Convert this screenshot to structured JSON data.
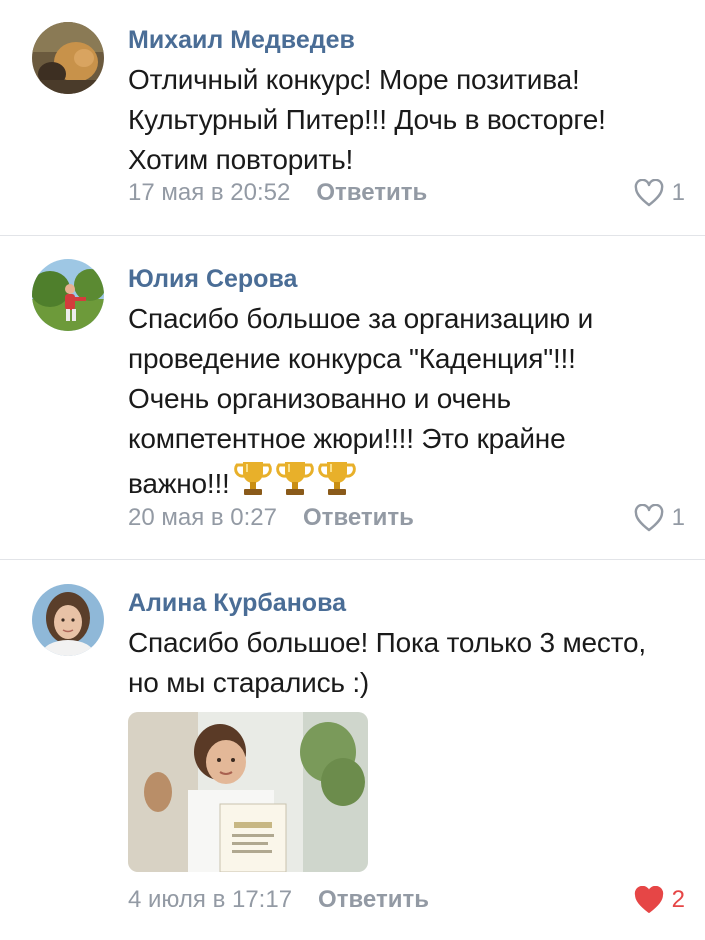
{
  "comments": [
    {
      "author": "Михаил Медведев",
      "text_lines": [
        "Отличный конкурс! Море позитива!",
        "Культурный Питер!!! Дочь в восторге!",
        "Хотим повторить!"
      ],
      "date": "17 мая в 20:52",
      "reply_label": "Ответить",
      "likes": "1",
      "liked": false
    },
    {
      "author": "Юлия Серова",
      "text_lines": [
        "Спасибо большое за организацию и",
        "проведение конкурса \"Каденция\"!!!",
        "Очень организованно и очень",
        "компетентное жюри!!!! Это крайне",
        "важно!!!"
      ],
      "trailing_emoji": [
        "trophy-icon",
        "trophy-icon",
        "trophy-icon"
      ],
      "date": "20 мая в 0:27",
      "reply_label": "Ответить",
      "likes": "1",
      "liked": false
    },
    {
      "author": "Алина Курбанова",
      "text_lines": [
        "Спасибо большое! Пока только 3 место,",
        "но мы старались :)"
      ],
      "date": "4 июля в 17:17",
      "reply_label": "Ответить",
      "likes": "2",
      "liked": true
    }
  ],
  "colors": {
    "author": "#4a6d96",
    "meta": "#939aa4",
    "liked": "#e64646",
    "divider": "#e2e4e8"
  }
}
